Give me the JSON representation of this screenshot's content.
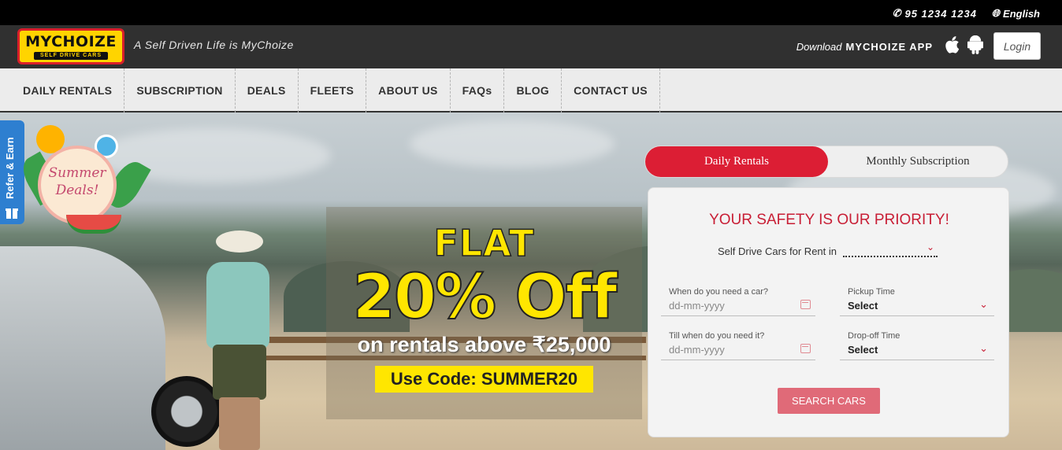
{
  "topbar": {
    "phone": "95 1234 1234",
    "language": "English"
  },
  "header": {
    "logo": {
      "brand": "MYCHOIZE",
      "sub": "SELF DRIVE CARS"
    },
    "tagline": "A Self Driven Life is MyChoize",
    "download_label": "Download",
    "download_app": "MYCHOIZE APP",
    "login_label": "Login"
  },
  "nav": {
    "items": [
      {
        "label": "DAILY RENTALS"
      },
      {
        "label": "SUBSCRIPTION"
      },
      {
        "label": "DEALS"
      },
      {
        "label": "FLEETS"
      },
      {
        "label": "ABOUT US"
      },
      {
        "label": "FAQs"
      },
      {
        "label": "BLOG"
      },
      {
        "label": "CONTACT US"
      }
    ]
  },
  "side": {
    "refer_label": "Refer & Earn",
    "badge_text": "Summer Deals!"
  },
  "promo": {
    "line1": "FLAT",
    "line2": "20% Off",
    "line3": "on rentals above ₹25,000",
    "code": "Use Code: SUMMER20"
  },
  "booking": {
    "tabs": {
      "active": "Daily Rentals",
      "inactive": "Monthly Subscription"
    },
    "headline": "YOUR SAFETY IS OUR PRIORITY!",
    "city_label": "Self Drive Cars for Rent in",
    "pickup_date": {
      "label": "When do you need a car?",
      "placeholder": "dd-mm-yyyy"
    },
    "pickup_time": {
      "label": "Pickup Time",
      "value": "Select"
    },
    "drop_date": {
      "label": "Till when do you need it?",
      "placeholder": "dd-mm-yyyy"
    },
    "drop_time": {
      "label": "Drop-off Time",
      "value": "Select"
    },
    "search_label": "SEARCH CARS"
  },
  "colors": {
    "brand_red": "#dc1e34",
    "brand_yellow": "#ffd400",
    "nav_bg": "#ececec"
  },
  "icons": [
    "phone-icon",
    "globe-icon",
    "apple-icon",
    "android-icon",
    "gift-icon",
    "calendar-icon",
    "chevron-down-icon"
  ]
}
